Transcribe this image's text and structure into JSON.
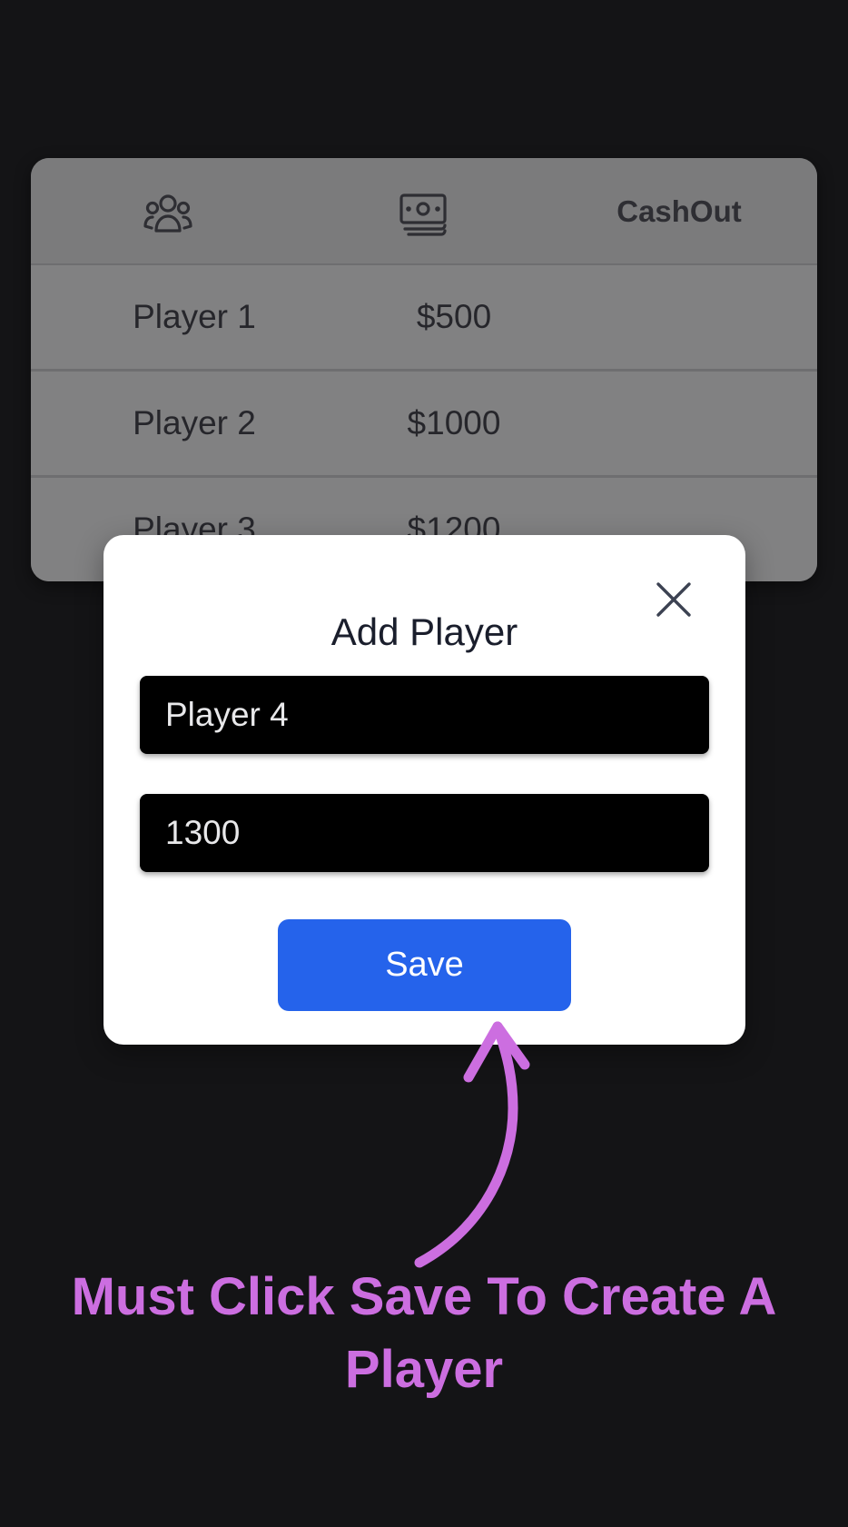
{
  "table": {
    "header": {
      "players_icon": "users-group-icon",
      "buyin_icon": "cash-icon",
      "cashout_label": "CashOut"
    },
    "rows": [
      {
        "name": "Player 1",
        "amount": "$500"
      },
      {
        "name": "Player 2",
        "amount": "$1000"
      },
      {
        "name": "Player 3",
        "amount": "$1200"
      }
    ]
  },
  "modal": {
    "title": "Add Player",
    "close_icon": "close-icon",
    "name_value": "Player 4",
    "amount_value": "1300",
    "save_label": "Save"
  },
  "annotation": {
    "caption": "Must Click Save To Create A Player",
    "arrow_icon": "curved-arrow-up-icon",
    "color": "#cc6ee0"
  },
  "colors": {
    "background": "#141416",
    "primary_button": "#2563eb",
    "modal_bg": "#ffffff",
    "input_bg": "#000000"
  }
}
